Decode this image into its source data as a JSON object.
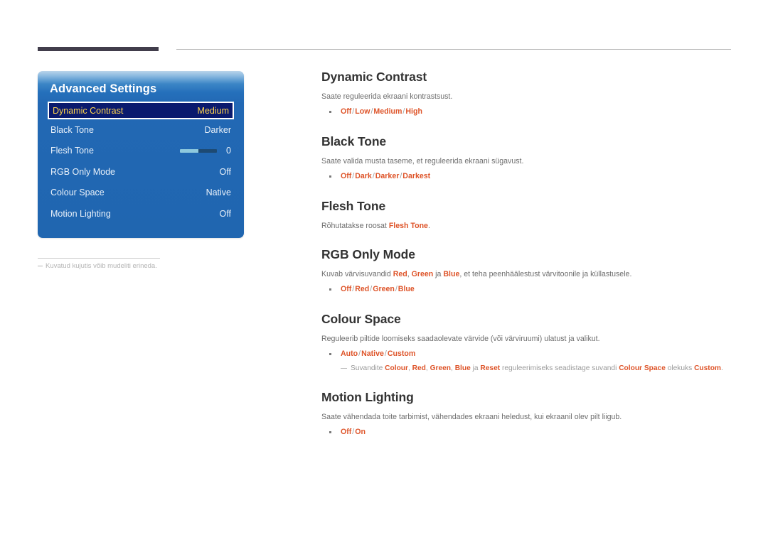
{
  "header": {
    "bar_color": "#413d4b",
    "rule_color": "#b9b9b9"
  },
  "osd_panel": {
    "title": "Advanced Settings",
    "accent_selected_text": "#ffd44d",
    "panel_color": "#2066b0",
    "rows": [
      {
        "label": "Dynamic Contrast",
        "value": "Medium",
        "selected": true,
        "type": "value"
      },
      {
        "label": "Black Tone",
        "value": "Darker",
        "selected": false,
        "type": "value"
      },
      {
        "label": "Flesh Tone",
        "value": "0",
        "selected": false,
        "type": "slider",
        "slider_percent": 50
      },
      {
        "label": "RGB Only Mode",
        "value": "Off",
        "selected": false,
        "type": "value"
      },
      {
        "label": "Colour Space",
        "value": "Native",
        "selected": false,
        "type": "value"
      },
      {
        "label": "Motion Lighting",
        "value": "Off",
        "selected": false,
        "type": "value"
      }
    ]
  },
  "footnote": {
    "text": "Kuvatud kujutis võib mudeliti erineda."
  },
  "sections": [
    {
      "id": "dynamic-contrast",
      "heading": "Dynamic Contrast",
      "desc": "Saate reguleerida ekraani kontrastsust.",
      "options": [
        "Off",
        "Low",
        "Medium",
        "High"
      ],
      "note": null
    },
    {
      "id": "black-tone",
      "heading": "Black Tone",
      "desc": "Saate valida musta taseme, et reguleerida ekraani sügavust.",
      "options": [
        "Off",
        "Dark",
        "Darker",
        "Darkest"
      ],
      "note": null
    },
    {
      "id": "flesh-tone",
      "heading": "Flesh Tone",
      "desc_parts": [
        {
          "text": "Rõhutatakse roosat ",
          "style": "plain"
        },
        {
          "text": "Flesh Tone",
          "style": "accent"
        },
        {
          "text": ".",
          "style": "plain"
        }
      ],
      "options": [],
      "note": null
    },
    {
      "id": "rgb-only-mode",
      "heading": "RGB Only Mode",
      "desc_parts": [
        {
          "text": "Kuvab värvisuvandid ",
          "style": "plain"
        },
        {
          "text": "Red",
          "style": "accent"
        },
        {
          "text": ", ",
          "style": "plain"
        },
        {
          "text": "Green",
          "style": "accent"
        },
        {
          "text": " ja ",
          "style": "plain"
        },
        {
          "text": "Blue",
          "style": "accent"
        },
        {
          "text": ", et teha peenhäälestust värvitoonile ja küllastusele.",
          "style": "plain"
        }
      ],
      "options": [
        "Off",
        "Red",
        "Green",
        "Blue"
      ],
      "note": null
    },
    {
      "id": "colour-space",
      "heading": "Colour Space",
      "desc": "Reguleerib piltide loomiseks saadaolevate värvide (või värviruumi) ulatust ja valikut.",
      "options": [
        "Auto",
        "Native",
        "Custom"
      ],
      "note_parts": [
        {
          "text": "Suvandite ",
          "style": "plain"
        },
        {
          "text": "Colour",
          "style": "accent"
        },
        {
          "text": ", ",
          "style": "plain"
        },
        {
          "text": "Red",
          "style": "accent"
        },
        {
          "text": ", ",
          "style": "plain"
        },
        {
          "text": "Green",
          "style": "accent"
        },
        {
          "text": ", ",
          "style": "plain"
        },
        {
          "text": "Blue",
          "style": "accent"
        },
        {
          "text": " ja ",
          "style": "plain"
        },
        {
          "text": "Reset",
          "style": "accent"
        },
        {
          "text": " reguleerimiseks seadistage suvandi ",
          "style": "plain"
        },
        {
          "text": "Colour Space",
          "style": "accent"
        },
        {
          "text": " olekuks ",
          "style": "plain"
        },
        {
          "text": "Custom",
          "style": "accent"
        },
        {
          "text": ".",
          "style": "plain"
        }
      ]
    },
    {
      "id": "motion-lighting",
      "heading": "Motion Lighting",
      "desc": "Saate vähendada toite tarbimist, vähendades ekraani heledust, kui ekraanil olev pilt liigub.",
      "options": [
        "Off",
        "On"
      ],
      "note": null
    }
  ],
  "colors": {
    "accent_orange": "#de5429",
    "body_gray": "#6d6d6d",
    "heading_gray": "#333333",
    "osd_blue": "#2066b0",
    "osd_selected_bg": "#0a1a6e"
  }
}
